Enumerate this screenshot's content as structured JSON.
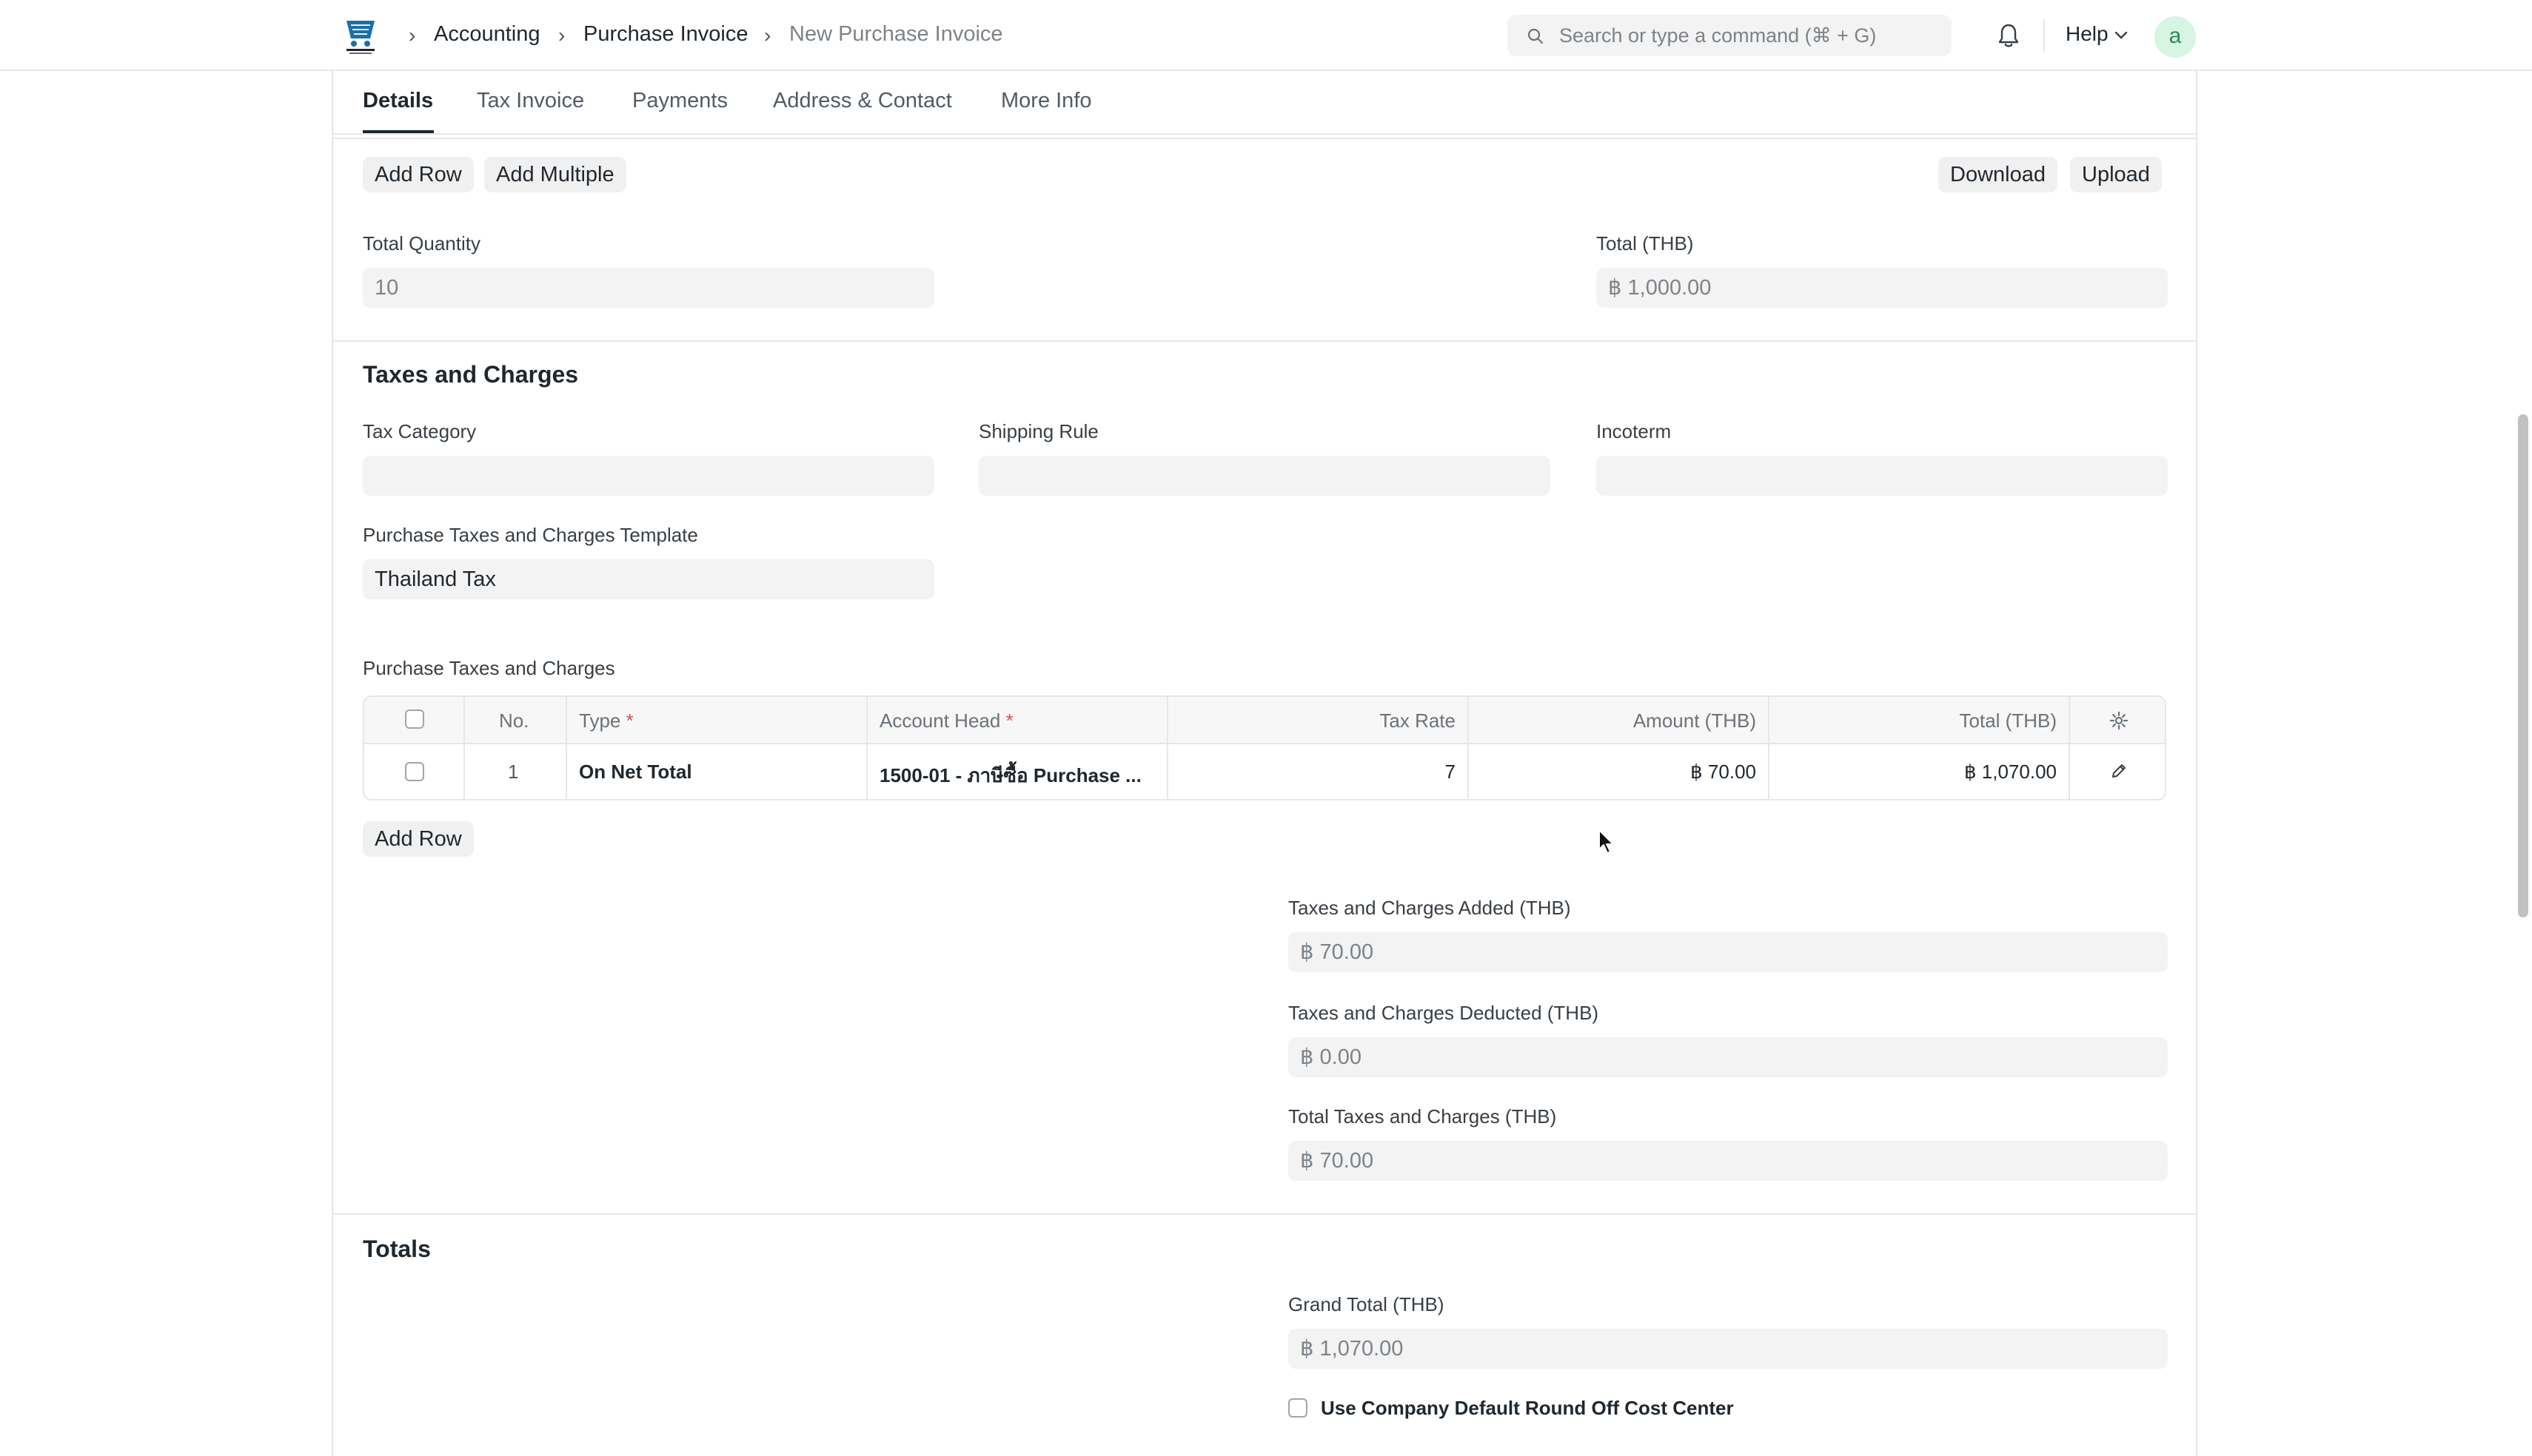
{
  "navbar": {
    "breadcrumbs": [
      "Accounting",
      "Purchase Invoice",
      "New Purchase Invoice"
    ],
    "search_placeholder": "Search or type a command (⌘ + G)",
    "help_label": "Help",
    "avatar_letter": "a"
  },
  "tabs": [
    "Details",
    "Tax Invoice",
    "Payments",
    "Address & Contact",
    "More Info"
  ],
  "items_toolbar": {
    "add_row": "Add Row",
    "add_multiple": "Add Multiple",
    "download": "Download",
    "upload": "Upload"
  },
  "items_summary": {
    "total_quantity_label": "Total Quantity",
    "total_quantity_value": "10",
    "total_label": "Total (THB)",
    "total_value": "฿ 1,000.00"
  },
  "taxes_section": {
    "title": "Taxes and Charges",
    "tax_category_label": "Tax Category",
    "tax_category_value": "",
    "shipping_rule_label": "Shipping Rule",
    "shipping_rule_value": "",
    "incoterm_label": "Incoterm",
    "incoterm_value": "",
    "template_label": "Purchase Taxes and Charges Template",
    "template_value": "Thailand Tax",
    "table_label": "Purchase Taxes and Charges",
    "columns": {
      "no": "No.",
      "type": "Type",
      "account_head": "Account Head",
      "tax_rate": "Tax Rate",
      "amount": "Amount (THB)",
      "total": "Total (THB)",
      "required_mark": "*"
    },
    "rows": [
      {
        "no": "1",
        "type": "On Net Total",
        "account_head": "1500-01 - ภาษีซื้อ Purchase ...",
        "tax_rate": "7",
        "amount": "฿ 70.00",
        "total": "฿ 1,070.00"
      }
    ],
    "add_row": "Add Row",
    "added_label": "Taxes and Charges Added (THB)",
    "added_value": "฿ 70.00",
    "deducted_label": "Taxes and Charges Deducted (THB)",
    "deducted_value": "฿ 0.00",
    "total_taxes_label": "Total Taxes and Charges (THB)",
    "total_taxes_value": "฿ 70.00"
  },
  "totals_section": {
    "title": "Totals",
    "grand_total_label": "Grand Total (THB)",
    "grand_total_value": "฿ 1,070.00",
    "round_off_label": "Use Company Default Round Off Cost Center",
    "round_off_checked": false
  },
  "colors": {
    "accent": "#1f272e",
    "field_bg": "#f3f3f3",
    "border": "#e5e7ea",
    "required": "#e24c4c"
  }
}
